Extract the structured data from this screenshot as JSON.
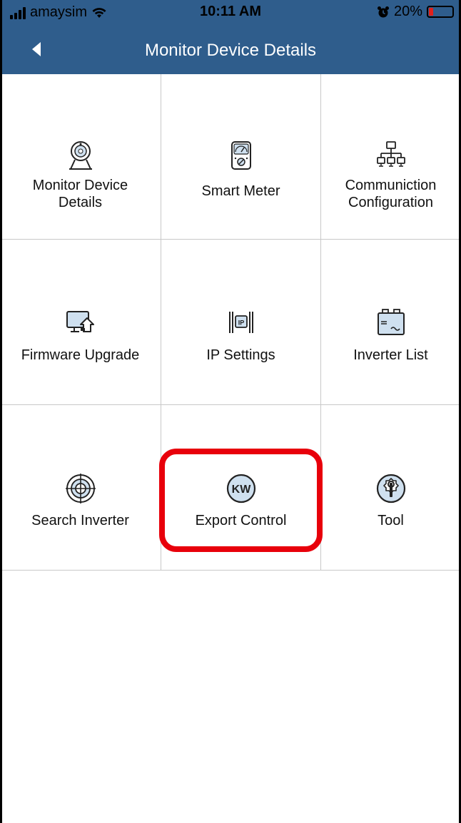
{
  "status_bar": {
    "carrier": "amaysim",
    "time": "10:11 AM",
    "battery": "20%",
    "battery_level": 0.2,
    "icons": [
      "signal-icon",
      "wifi-icon",
      "alarm-icon",
      "battery-icon"
    ]
  },
  "nav": {
    "title": "Monitor Device Details",
    "back_icon": "back-arrow-icon"
  },
  "accent_color": "#2f5d8c",
  "highlight_color": "#e8000b",
  "grid": {
    "items": [
      {
        "label_line1": "Monitor Device",
        "label_line2": "Details",
        "icon": "webcam-icon"
      },
      {
        "label_line1": "Smart Meter",
        "label_line2": "",
        "icon": "smart-meter-icon"
      },
      {
        "label_line1": "Communiction",
        "label_line2": "Configuration",
        "icon": "network-icon"
      },
      {
        "label_line1": "Firmware Upgrade",
        "label_line2": "",
        "icon": "firmware-upgrade-icon"
      },
      {
        "label_line1": "IP Settings",
        "label_line2": "",
        "icon": "ip-settings-icon"
      },
      {
        "label_line1": "Inverter List",
        "label_line2": "",
        "icon": "inverter-icon"
      },
      {
        "label_line1": "Search Inverter",
        "label_line2": "",
        "icon": "target-icon"
      },
      {
        "label_line1": "Export Control",
        "label_line2": "",
        "icon": "kw-icon"
      },
      {
        "label_line1": "Tool",
        "label_line2": "",
        "icon": "tool-icon"
      }
    ]
  }
}
